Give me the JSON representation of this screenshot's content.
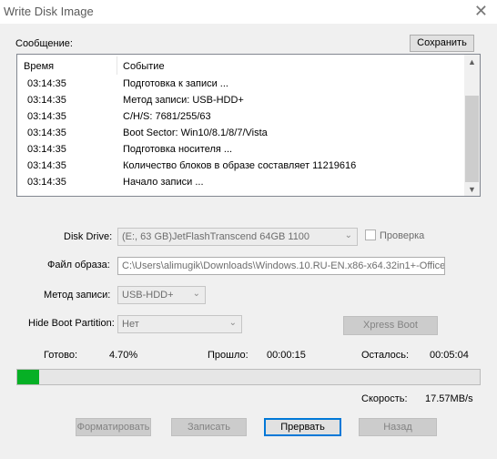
{
  "window": {
    "title": "Write Disk Image",
    "close_glyph": "✕"
  },
  "log": {
    "label": "Сообщение:",
    "save_button": "Сохранить",
    "columns": {
      "time": "Время",
      "event": "Событие"
    },
    "rows": [
      {
        "time": "03:14:35",
        "event": "Подготовка к записи ..."
      },
      {
        "time": "03:14:35",
        "event": "Метод записи: USB-HDD+"
      },
      {
        "time": "03:14:35",
        "event": "C/H/S: 7681/255/63"
      },
      {
        "time": "03:14:35",
        "event": "Boot Sector: Win10/8.1/8/7/Vista"
      },
      {
        "time": "03:14:35",
        "event": "Подготовка носителя ..."
      },
      {
        "time": "03:14:35",
        "event": "Количество блоков в образе составляет 11219616"
      },
      {
        "time": "03:14:35",
        "event": "Начало записи ..."
      }
    ]
  },
  "form": {
    "disk_drive_label": "Disk Drive:",
    "disk_drive_value": "(E:, 63 GB)JetFlashTranscend 64GB  1100",
    "verify_label": "Проверка",
    "verify_checked": false,
    "image_file_label": "Файл образа:",
    "image_file_value": "C:\\Users\\alimugik\\Downloads\\Windows.10.RU-EN.x86-x64.32in1+-Office.",
    "write_method_label": "Метод записи:",
    "write_method_value": "USB-HDD+",
    "hide_boot_label": "Hide Boot Partition:",
    "hide_boot_value": "Нет",
    "xpress_boot_button": "Xpress Boot"
  },
  "status": {
    "done_label": "Готово:",
    "done_value": "4.70%",
    "elapsed_label": "Прошло:",
    "elapsed_value": "00:00:15",
    "remaining_label": "Осталось:",
    "remaining_value": "00:05:04",
    "progress_fraction": 0.047,
    "speed_label": "Скорость:",
    "speed_value": "17.57MB/s"
  },
  "buttons": {
    "format": "Форматировать",
    "write": "Записать",
    "abort": "Прервать",
    "back": "Назад"
  },
  "colors": {
    "progress_fill": "#06b025",
    "background": "#f0f0f0"
  }
}
